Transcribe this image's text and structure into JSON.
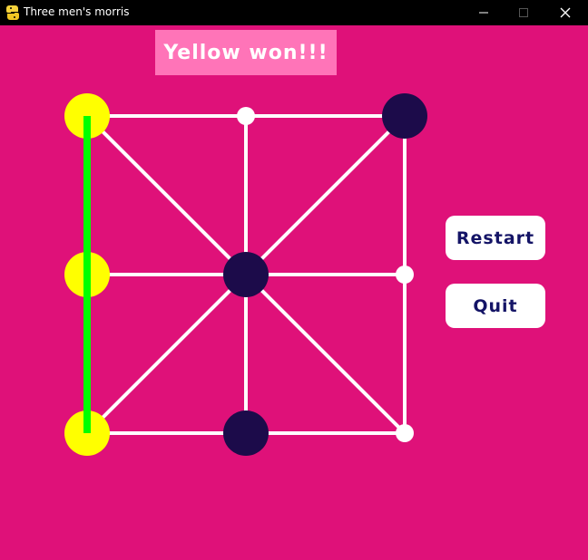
{
  "window": {
    "title": "Three men's morris",
    "icon": "python-icon"
  },
  "status": {
    "message": "Yellow won!!!"
  },
  "buttons": {
    "restart": "Restart",
    "quit": "Quit"
  },
  "colors": {
    "background": "#df1179",
    "status_bg": "#ff74b8",
    "yellow_piece": "#ffff00",
    "dark_piece": "#1c0b4a",
    "board_lines": "#ffffff",
    "win_line": "#00ff00",
    "button_text": "#141466"
  },
  "board": {
    "rows": 3,
    "cols": 3,
    "cells": [
      [
        "yellow",
        "empty",
        "dark"
      ],
      [
        "yellow",
        "dark",
        "empty"
      ],
      [
        "yellow",
        "dark",
        "empty"
      ]
    ],
    "winning_line": {
      "player": "yellow",
      "column": 0
    }
  }
}
